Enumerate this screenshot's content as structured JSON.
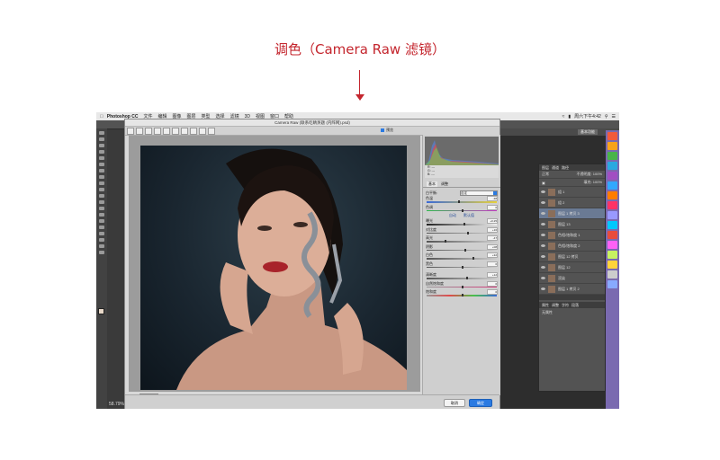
{
  "caption": "调色（Camera Raw 滤镜）",
  "menubar": {
    "app_name": "Photoshop CC",
    "items": [
      "文件",
      "编辑",
      "图像",
      "图层",
      "类型",
      "选择",
      "滤镜",
      "3D",
      "视图",
      "窗口",
      "帮助"
    ],
    "clock": "周六下午4:42"
  },
  "workspace": {
    "zoom_label": "58.79%",
    "background_button": "基本功能"
  },
  "camera_raw": {
    "title": "Camera Raw (联系吃睛蒸题 (内阵网).psd)",
    "preview_label": "预览",
    "zoom_value": "56%",
    "panel_tabs": [
      "基本",
      "调整"
    ],
    "white_balance_label": "白平衡:",
    "white_balance_value": "自定",
    "temperature_label": "色温",
    "temperature_value": "-38",
    "tint_label": "色调",
    "tint_value": "0",
    "auto_label": "自动",
    "default_label": "默认值",
    "exposure_label": "曝光",
    "exposure_value": "+0.25",
    "contrast_label": "对比度",
    "contrast_value": "+16",
    "highlights_label": "高光",
    "highlights_value": "-47",
    "shadows_label": "阴影",
    "shadows_value": "+08",
    "whites_label": "白色",
    "whites_value": "+32",
    "blacks_label": "黑色",
    "blacks_value": "0",
    "clarity_label": "清晰度",
    "clarity_value": "+12",
    "vibrance_label": "自然饱和度",
    "vibrance_value": "0",
    "saturation_label": "饱和度",
    "saturation_value": "0",
    "cancel_label": "取消",
    "ok_label": "确定"
  },
  "layers_panel": {
    "tabs": [
      "图层",
      "通道",
      "路径"
    ],
    "blend_mode": "正常",
    "opacity_label": "不透明度:",
    "opacity_value": "100%",
    "fill_label": "填充:",
    "fill_value": "100%",
    "layers": [
      {
        "name": "组 1"
      },
      {
        "name": "组 2"
      },
      {
        "name": "图层 1 拷贝 3"
      },
      {
        "name": "图层 13"
      },
      {
        "name": "色相/饱和度 1"
      },
      {
        "name": "色相/饱和度 2"
      },
      {
        "name": "图层 12 拷贝"
      },
      {
        "name": "图层 12"
      },
      {
        "name": "渲染"
      },
      {
        "name": "图层 1 拷贝 2"
      }
    ],
    "props_tabs": [
      "属性",
      "调整",
      "字符",
      "段落"
    ],
    "props_body": "无属性"
  },
  "dock_colors": [
    "#f25a3c",
    "#f7a21b",
    "#49b44a",
    "#2aa8e0",
    "#a14fc2",
    "#31a8ff",
    "#ff7c00",
    "#ff3366",
    "#9999ff",
    "#00c8ff",
    "#e84c3d",
    "#ff61f6",
    "#c8f261",
    "#ffd43b",
    "#cccccc",
    "#88aaff"
  ]
}
